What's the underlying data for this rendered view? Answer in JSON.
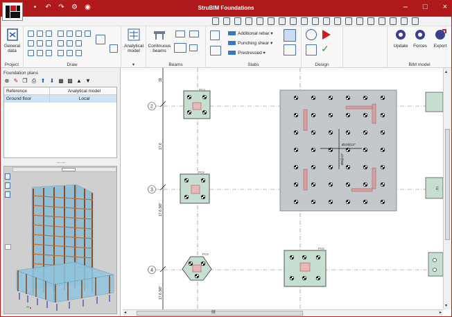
{
  "window": {
    "title": "StruBIM Foundations",
    "minimize": "–",
    "maximize": "□",
    "close": "×"
  },
  "ribbon": {
    "groups": {
      "project": {
        "label": "Project",
        "general_data": "General data"
      },
      "draw": {
        "label": "Draw"
      },
      "analytical": {
        "label": "Analytical model",
        "collapse": "▾"
      },
      "beams": {
        "label": "Beams",
        "continuous_beams": "Continuous beams"
      },
      "slabs": {
        "label": "Slabs",
        "additional_rebar": "Additional rebar ▾",
        "punching_shear": "Punching shear ▾",
        "prestressed": "Prestressed ▾"
      },
      "design": {
        "label": "Design"
      },
      "bim": {
        "label": "BIM model",
        "update": "Update",
        "forces": "Forces",
        "export": "Export"
      }
    }
  },
  "foundation_plans": {
    "title": "Foundation plans",
    "columns": [
      "Reference",
      "Analytical model"
    ],
    "rows": [
      {
        "reference": "Ground floor",
        "model": "Local"
      }
    ]
  },
  "drawing": {
    "axes": [
      "2",
      "3",
      "4"
    ],
    "dims": [
      "17.6",
      "17.6 3/8\"",
      "17.6 3/8\""
    ],
    "footing_labels": [
      "PC3",
      "PC6",
      "PC9",
      "PC8"
    ],
    "slab_note": "Ø10@12\"",
    "slab_note2": "Ø8@12\"",
    "right_tag": "E"
  },
  "scrollbar": {
    "h_label": "III"
  },
  "colors": {
    "titlebar": "#b0191c",
    "footing": "#c7dfd0",
    "slab": "#c4c8cc",
    "pedestal": "#e9b7b7"
  }
}
